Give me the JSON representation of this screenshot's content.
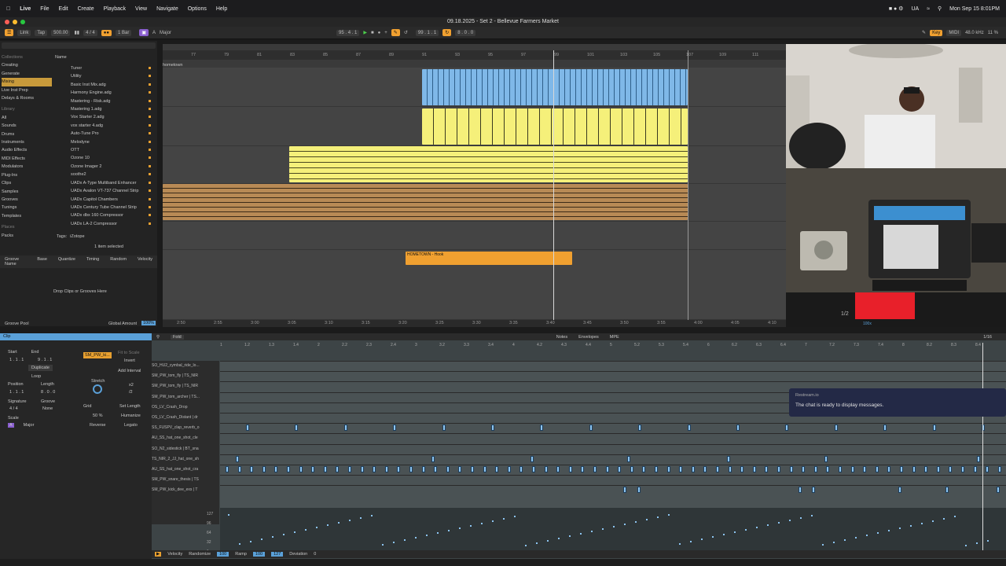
{
  "menubar": {
    "app": "Live",
    "items": [
      "File",
      "Edit",
      "Create",
      "Playback",
      "View",
      "Navigate",
      "Options",
      "Help"
    ],
    "clock": "Mon Sep 15 8:01PM",
    "lang": "UA"
  },
  "window": {
    "title": "09.18.2025 - Set 2 - Bellevue Farmers Market"
  },
  "transport": {
    "link": "Link",
    "tap": "Tap",
    "tempo": "500.00",
    "signature": "4 / 4",
    "bar": "1 Bar",
    "scale_root": "A",
    "scale_name": "Major",
    "position": "95 . 4 . 1",
    "loop_start": "99 . 1 . 1",
    "loop_len": "8 . 0 . 0",
    "key": "Key",
    "midi": "MIDI",
    "sample_rate": "48.0 kHz",
    "cpu": "11 %"
  },
  "browser": {
    "collections_label": "Collections",
    "collections": [
      "Creating",
      "Generate",
      "Mixing",
      "Live Inst Prep",
      "Delays & Rooms"
    ],
    "library_label": "Library",
    "library": [
      "All",
      "Sounds",
      "Drums",
      "Instruments",
      "Audio Effects",
      "MIDI Effects",
      "Modulators",
      "Plug-Ins",
      "Clips",
      "Samples",
      "Grooves",
      "Tunings",
      "Templates"
    ],
    "places_label": "Places",
    "places": [
      "Packs"
    ],
    "name_header": "Name",
    "files": [
      "Tuner",
      "Utility",
      "Basic Inst Mix.adg",
      "Harmony Engine.adg",
      "Mastering - Risk.adg",
      "Mastering 1.adg",
      "Vox Starter 2.adg",
      "vox starter 4.adg",
      "Auto-Tune Pro",
      "Melodyne",
      "OTT",
      "Ozone 10",
      "Ozone Imager 2",
      "soothe2",
      "UADx A-Type Multiband Enhancer",
      "UADx Avalon VT-737 Channel Strip",
      "UADx Capitol Chambers",
      "UADx Century Tube Channel Strip",
      "UADx dbx 160 Compressor",
      "UADx LA-2 Compressor"
    ],
    "tags_label": "Tags:",
    "tag": "iZotope",
    "selected": "1 item selected"
  },
  "groove": {
    "headers": [
      "Groove Name",
      "Base",
      "Quantize",
      "Timing",
      "Random",
      "Velocity"
    ],
    "empty": "Drop Clips or Grooves Here",
    "pool": "Groove Pool",
    "global": "Global Amount",
    "global_value": "100%"
  },
  "arrangement": {
    "bars": [
      "77",
      "79",
      "81",
      "83",
      "85",
      "87",
      "89",
      "91",
      "93",
      "95",
      "97",
      "99",
      "101",
      "103",
      "105",
      "107",
      "109",
      "111"
    ],
    "times": [
      "2:50",
      "2:55",
      "3:00",
      "3:05",
      "3:10",
      "3:15",
      "3:20",
      "3:25",
      "3:30",
      "3:35",
      "3:40",
      "3:45",
      "3:50",
      "3:55",
      "4:00",
      "4:05",
      "4:10",
      "4:15",
      "4:20"
    ],
    "marker": "hometown",
    "clip_label": "HOMETOWN - Hook",
    "colors": {
      "blue": "#8cc4f0",
      "yellow": "#f5f07a",
      "brown": "#b88a55",
      "orange": "#f0a030"
    }
  },
  "camera": {
    "page": "1/2",
    "rec": "100x"
  },
  "clip_panel": {
    "title": "Clip",
    "start": "Start",
    "end": "End",
    "start_val": "1 . 1 . 1",
    "end_val": "9 . 1 . 1",
    "duplicate": "Duplicate",
    "loop": "Loop",
    "position": "Position",
    "length": "Length",
    "pos_val": "1 . 1 . 1",
    "len_val": "8 . 0 . 0",
    "signature": "Signature",
    "groove_lbl": "Groove",
    "sig_val": "4 / 4",
    "groove_val": "None",
    "scale": "Scale",
    "scale_root": "A",
    "scale_name": "Major",
    "fit_to_scale": "Fit to Scale",
    "invert": "Invert",
    "add_interval": "Add Interval",
    "stretch": "Stretch",
    "x2": "x2",
    "div2": "/2",
    "grid": "Grid",
    "set_length": "Set Length",
    "humanize": "Humanize",
    "reverse": "Reverse",
    "legato": "Legato",
    "pct": "50 %",
    "device": "SM_PW_ki..."
  },
  "midi_editor": {
    "tabs": [
      "Notes",
      "Envelopes",
      "MPE"
    ],
    "fold": "Fold",
    "zoom": "1/16",
    "bar_marks": [
      "1",
      "1.2",
      "1.3",
      "1.4",
      "2",
      "2.2",
      "2.3",
      "2.4",
      "3",
      "3.2",
      "3.3",
      "3.4",
      "4",
      "4.2",
      "4.3",
      "4.4",
      "5",
      "5.2",
      "5.3",
      "5.4",
      "6",
      "6.2",
      "6.3",
      "6.4",
      "7",
      "7.2",
      "7.3",
      "7.4",
      "8",
      "8.2",
      "8.3",
      "8.4"
    ],
    "lanes": [
      "SO_HU2_cymbal_ride_lo...",
      "SM_PW_tom_fly | TS_NIR",
      "SM_PW_tom_fly | TS_NIR",
      "SM_PW_tom_archer | TS...",
      "OS_LV_Crash_Drop",
      "OS_LV_Crash_Distant | dr",
      "SS_FUSPV_clap_reverb_o",
      "AU_SS_hat_one_shot_cle",
      "SO_N2_sidestick | BT_sna",
      "TS_NIR_2_JJ_hat_one_sh",
      "AU_SS_hat_one_shot_cra",
      "SM_PW_snare_thesis | TS",
      "SM_PW_kick_dee_exs | T"
    ],
    "vel_scale": [
      "127",
      "96",
      "64",
      "32",
      "1"
    ],
    "footer": {
      "velocity": "Velocity",
      "randomize": "Randomize",
      "rand_val": "100",
      "ramp": "Ramp",
      "ramp_a": "100",
      "ramp_b": "127",
      "deviation": "Deviation",
      "dev_val": "0"
    }
  },
  "toast": {
    "source": "Restream.io",
    "message": "The chat is ready to display messages."
  }
}
